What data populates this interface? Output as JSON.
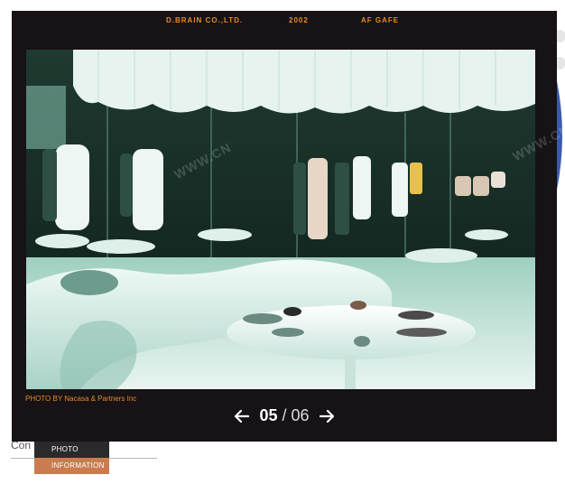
{
  "header": {
    "company": "D.BRAIN CO.,LTD.",
    "year": "2002",
    "project": "AF GAFE"
  },
  "photo": {
    "credit": "PHOTO BY Nacasa & Partners Inc",
    "description_icon": "boutique-interior-photo"
  },
  "pager": {
    "current": "05",
    "separator": "/",
    "total": "06",
    "prev_icon": "arrow-left-icon",
    "next_icon": "arrow-right-icon"
  },
  "tabs": [
    {
      "label": "PHOTO"
    },
    {
      "label": "INFORMATION"
    }
  ],
  "background_text": "Con",
  "watermarks": [
    "WWW.CN",
    "WWW.CN",
    "WWW.CN"
  ],
  "colors": {
    "viewer_bg": "#161215",
    "accent": "#e58a2b",
    "tab_info": "#c97c4f"
  }
}
